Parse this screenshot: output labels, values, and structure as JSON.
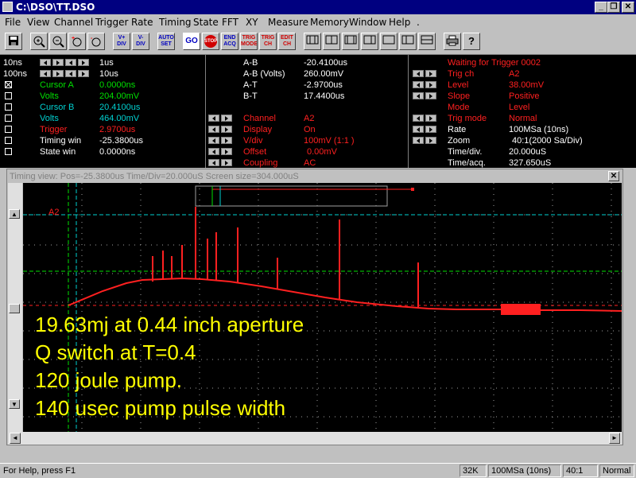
{
  "window": {
    "title": "C:\\DSO\\TT.DSO"
  },
  "menu": [
    "File",
    "View",
    "Channel",
    "Trigger",
    "Rate",
    "Timing",
    "State",
    "FFT",
    "XY",
    "Measure",
    "Memory",
    "Window",
    "Help",
    "."
  ],
  "toolbar": {
    "vdiv_up": "V+\nDIV",
    "vdiv_down": "V-\nDIV",
    "auto_set": "AUTO\nSET",
    "go": "GO",
    "stop": "STOP",
    "end_acq": "END\nACQ",
    "trig_mode": "TRIG\nMODE",
    "trig_ch": "TRIG\nCH",
    "edit_ch": "EDIT\nCH"
  },
  "left_panel": {
    "rows": [
      {
        "label": "10ns",
        "value": "1us"
      },
      {
        "label": "100ns",
        "value": "10us"
      }
    ],
    "params": [
      {
        "label": "Cursor A",
        "value": "0.0000ns",
        "checked": true
      },
      {
        "label": "Volts",
        "value": "204.00mV",
        "checked": false
      },
      {
        "label": "Cursor B",
        "value": "20.4100us",
        "checked": false
      },
      {
        "label": "Volts",
        "value": "464.00mV",
        "checked": false
      },
      {
        "label": "Trigger",
        "value": "2.9700us",
        "checked": false
      },
      {
        "label": "Timing win",
        "value": "-25.3800us",
        "checked": false
      },
      {
        "label": "State win",
        "value": "0.0000ns",
        "checked": false
      }
    ]
  },
  "mid_panel": {
    "measure": [
      {
        "label": "A-B",
        "value": "-20.4100us"
      },
      {
        "label": "A-B (Volts)",
        "value": "260.00mV"
      },
      {
        "label": "A-T",
        "value": "-2.9700us"
      },
      {
        "label": "B-T",
        "value": "17.4400us"
      }
    ],
    "channel": [
      {
        "label": "Channel",
        "value": "A2"
      },
      {
        "label": "Display",
        "value": "On"
      },
      {
        "label": "V/div",
        "value": "100mV (1:1   )"
      },
      {
        "label": "Offset",
        "value": "0.00mV"
      },
      {
        "label": "Coupling",
        "value": "AC"
      }
    ]
  },
  "right_panel": {
    "status": "Waiting for Trigger 0002",
    "trigger": [
      {
        "label": "Trig ch",
        "value": "A2"
      },
      {
        "label": "Level",
        "value": "38.00mV"
      },
      {
        "label": "Slope",
        "value": "Positive"
      },
      {
        "label": "Mode",
        "value": "Level"
      },
      {
        "label": "Trig mode",
        "value": "Normal"
      }
    ],
    "rate": [
      {
        "label": "Rate",
        "value": "100MSa (10ns)"
      },
      {
        "label": "Zoom",
        "value": "40:1(2000 Sa/Div)"
      },
      {
        "label": "Time/div.",
        "value": "20.000uS"
      },
      {
        "label": "Time/acq.",
        "value": "327.650uS"
      }
    ]
  },
  "timing_window": {
    "title": "Timing view: Pos=-25.3800us Time/Div=20.000uS Screen size=304.000uS",
    "channel_label": "A2",
    "annotations": [
      "19.63mj at 0.44 inch aperture",
      "Q switch at T=0.4",
      "120 joule pump.",
      "140 usec pump pulse width"
    ]
  },
  "statusbar": {
    "help": "For Help, press F1",
    "memory": "32K",
    "rate": "100MSa (10ns)",
    "zoom": "40:1",
    "mode": "Normal"
  },
  "colors": {
    "trace": "#ff2020",
    "annotation": "#ffff00",
    "grid": "#a0a0a0",
    "cursor_a": "#00e000",
    "cursor_b": "#00d0d0"
  }
}
